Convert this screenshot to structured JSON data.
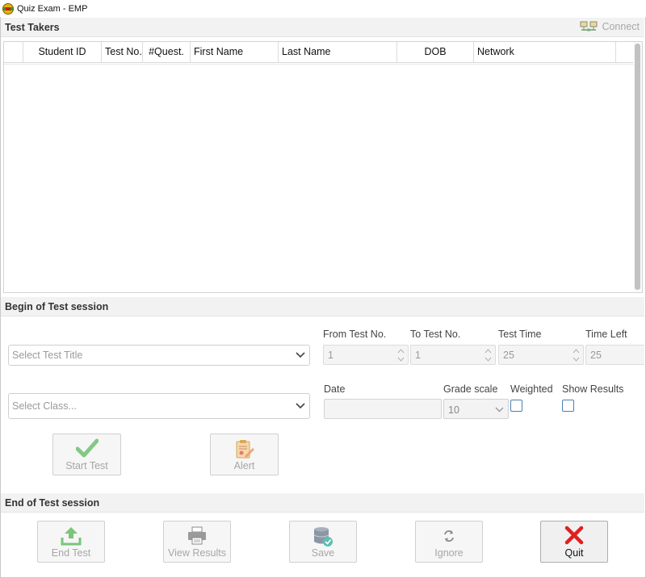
{
  "window": {
    "title": "Quiz Exam - EMP"
  },
  "test_takers": {
    "title": "Test Takers",
    "connect_label": "Connect",
    "columns": [
      "Student ID",
      "Test No.",
      "#Quest.",
      "First Name",
      "Last Name",
      "DOB",
      "Network"
    ]
  },
  "begin_session": {
    "title": "Begin of Test session",
    "test_title_placeholder": "Select Test Title",
    "class_placeholder": "Select Class...",
    "from_test_no": {
      "label": "From Test No.",
      "value": "1"
    },
    "to_test_no": {
      "label": "To Test No.",
      "value": "1"
    },
    "test_time": {
      "label": "Test Time",
      "value": "25"
    },
    "time_left": {
      "label": "Time Left",
      "value": "25"
    },
    "date": {
      "label": "Date",
      "value": ""
    },
    "grade_scale": {
      "label": "Grade scale",
      "value": "10"
    },
    "weighted": {
      "label": "Weighted",
      "checked": false
    },
    "show_results": {
      "label": "Show Results",
      "checked": false
    },
    "start_test_label": "Start Test",
    "alert_label": "Alert"
  },
  "end_session": {
    "title": "End of Test session",
    "end_test_label": "End Test",
    "view_results_label": "View Results",
    "save_label": "Save",
    "ignore_label": "Ignore",
    "quit_label": "Quit"
  },
  "colors": {
    "accent_green": "#5cb85c",
    "quit_red": "#e02020",
    "checkbox_blue": "#4a7fb0"
  },
  "icons": {
    "connect": "network-icon",
    "start_test": "checkmark-icon",
    "alert": "clipboard-pencil-icon",
    "end_test": "upload-tray-icon",
    "view_results": "printer-icon",
    "save": "database-check-icon",
    "ignore": "refresh-icon",
    "quit": "x-mark-icon"
  }
}
